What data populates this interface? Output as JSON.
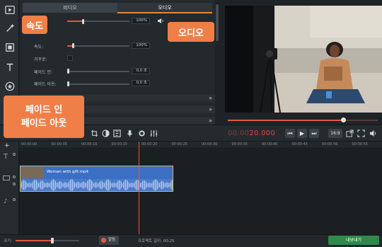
{
  "panel": {
    "tabs": [
      {
        "label": "비디오"
      },
      {
        "label": "오디오"
      }
    ],
    "rows": {
      "volume_value": "100%",
      "speed_label": "속도:",
      "speed_value": "100%",
      "reverse_label": "거꾸로:",
      "fade_in_label": "페이드 인:",
      "fade_in_value": "0,0 초",
      "fade_out_label": "페이드 아웃:",
      "fade_out_value": "0,0 초"
    },
    "collapse_chevron": "»"
  },
  "callouts": {
    "speed": "속도",
    "audio": "오디오",
    "fade_line1": "페이드 인",
    "fade_line2": "페이드 아웃"
  },
  "player": {
    "timecode_dim": "00:00",
    "timecode_main": "20.000",
    "aspect": "16:9",
    "seek_progress": 0.77
  },
  "timeline": {
    "ruler_ticks": [
      "00:00:00",
      "00:00:05",
      "00:00:10",
      "00:00:15",
      "00:00:20",
      "00:00:25",
      "00:00:30",
      "00:00:35",
      "00:00:40",
      "00:00:45",
      "00:00:50",
      "00:00:55"
    ],
    "clip_name": "Woman with gift.mp4"
  },
  "bottombar": {
    "zoom_label": "크기:",
    "notify_label": "알림",
    "duration_label": "프로젝트 길이: 00:25",
    "export_label": "내보내기"
  },
  "colors": {
    "accent_orange": "#ef7f47",
    "accent_red": "#e25a45",
    "export_green": "#2f8a4a",
    "clip_blue": "#3b6fc4",
    "clip_border": "#e0b33a"
  }
}
